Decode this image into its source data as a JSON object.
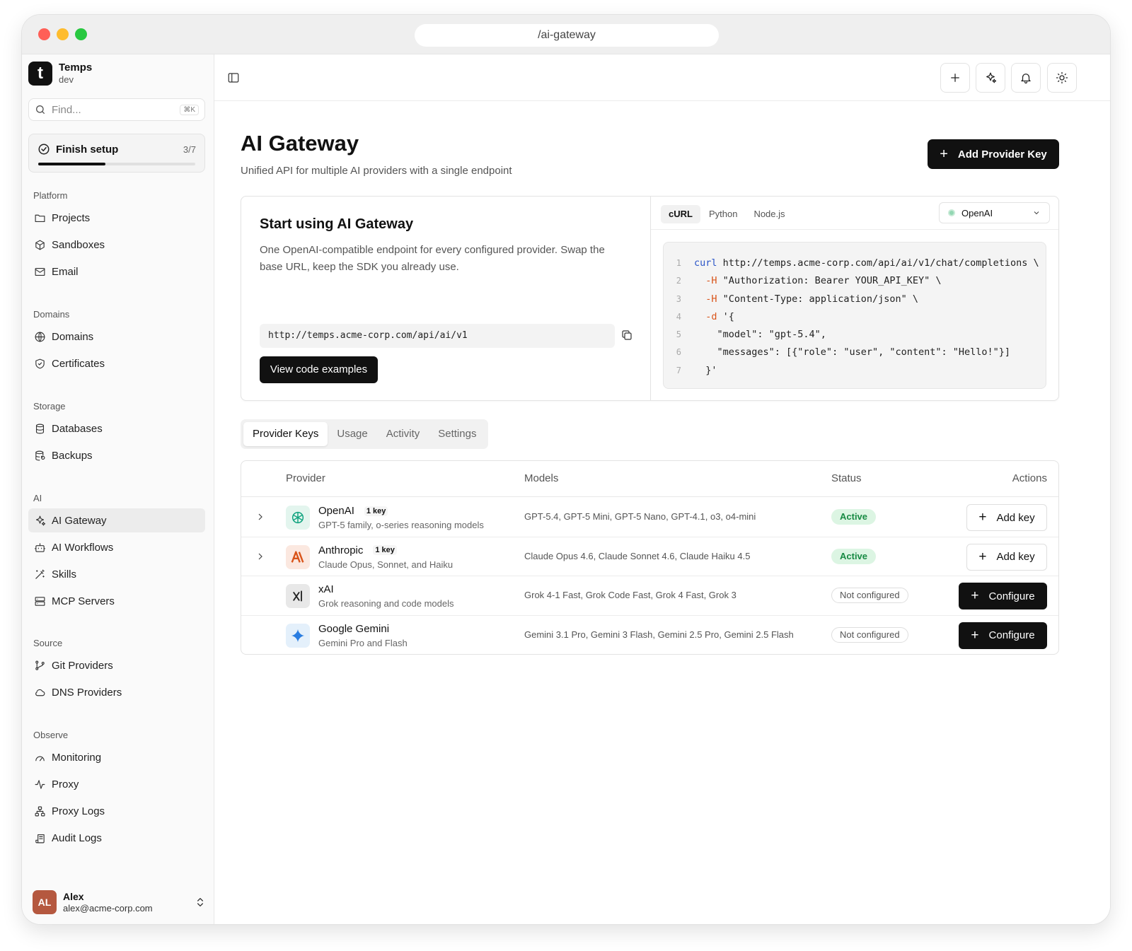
{
  "browser": {
    "url": "/ai-gateway"
  },
  "brand": {
    "logo_letter": "t",
    "name": "Temps",
    "env": "dev"
  },
  "search": {
    "placeholder": "Find...",
    "shortcut": "⌘K"
  },
  "setup": {
    "label": "Finish setup",
    "count": "3/7",
    "progress": 0.43
  },
  "nav": {
    "platform": {
      "heading": "Platform",
      "items": [
        "Projects",
        "Sandboxes",
        "Email"
      ]
    },
    "domains": {
      "heading": "Domains",
      "items": [
        "Domains",
        "Certificates"
      ]
    },
    "storage": {
      "heading": "Storage",
      "items": [
        "Databases",
        "Backups"
      ]
    },
    "ai": {
      "heading": "AI",
      "items": [
        "AI Gateway",
        "AI Workflows",
        "Skills",
        "MCP Servers"
      ]
    },
    "source": {
      "heading": "Source",
      "items": [
        "Git Providers",
        "DNS Providers"
      ]
    },
    "observe": {
      "heading": "Observe",
      "items": [
        "Monitoring",
        "Proxy",
        "Proxy Logs",
        "Audit Logs"
      ]
    }
  },
  "user": {
    "initials": "AL",
    "name": "Alex",
    "email": "alex@acme-corp.com"
  },
  "header": {
    "title": "AI Gateway",
    "subtitle": "Unified API for multiple AI providers with a single endpoint",
    "primary_button": "Add Provider Key"
  },
  "quickstart": {
    "title": "Start using AI Gateway",
    "description": "One OpenAI-compatible endpoint for every configured provider. Swap the base URL, keep the SDK you already use.",
    "endpoint": "http://temps.acme-corp.com/api/ai/v1",
    "button": "View code examples",
    "code_tabs": [
      "cURL",
      "Python",
      "Node.js"
    ],
    "active_code_tab": "cURL",
    "selected_provider": "OpenAI",
    "code_lines": [
      {
        "n": "1",
        "kw": "curl",
        "flag": "",
        "text": " http://temps.acme-corp.com/api/ai/v1/chat/completions \\"
      },
      {
        "n": "2",
        "kw": "",
        "flag": "  -H",
        "text": " \"Authorization: Bearer YOUR_API_KEY\" \\"
      },
      {
        "n": "3",
        "kw": "",
        "flag": "  -H",
        "text": " \"Content-Type: application/json\" \\"
      },
      {
        "n": "4",
        "kw": "",
        "flag": "  -d",
        "text": " '{"
      },
      {
        "n": "5",
        "kw": "",
        "flag": "",
        "text": "    \"model\": \"gpt-5.4\","
      },
      {
        "n": "6",
        "kw": "",
        "flag": "",
        "text": "    \"messages\": [{\"role\": \"user\", \"content\": \"Hello!\"}]"
      },
      {
        "n": "7",
        "kw": "",
        "flag": "",
        "text": "  }'"
      }
    ]
  },
  "tabs": {
    "items": [
      "Provider Keys",
      "Usage",
      "Activity",
      "Settings"
    ],
    "active": "Provider Keys"
  },
  "table": {
    "columns": {
      "provider": "Provider",
      "models": "Models",
      "status": "Status",
      "actions": "Actions"
    },
    "rows": [
      {
        "name": "OpenAI",
        "badge": "1 key",
        "description": "GPT-5 family, o-series reasoning models",
        "models": "GPT-5.4, GPT-5 Mini, GPT-5 Nano, GPT-4.1, o3, o4-mini",
        "status": "Active",
        "action": "Add key",
        "icon": "openai-icon"
      },
      {
        "name": "Anthropic",
        "badge": "1 key",
        "description": "Claude Opus, Sonnet, and Haiku",
        "models": "Claude Opus 4.6, Claude Sonnet 4.6, Claude Haiku 4.5",
        "status": "Active",
        "action": "Add key",
        "icon": "anthropic-icon"
      },
      {
        "name": "xAI",
        "badge": "",
        "description": "Grok reasoning and code models",
        "models": "Grok 4-1 Fast, Grok Code Fast, Grok 4 Fast, Grok 3",
        "status": "Not configured",
        "action": "Configure",
        "icon": "xai-icon"
      },
      {
        "name": "Google Gemini",
        "badge": "",
        "description": "Gemini Pro and Flash",
        "models": "Gemini 3.1 Pro, Gemini 3 Flash, Gemini 2.5 Pro, Gemini 2.5 Flash",
        "status": "Not configured",
        "action": "Configure",
        "icon": "gemini-icon"
      }
    ]
  },
  "colors": {
    "accent": "#111111",
    "active_bg": "#dcf5e3",
    "active_text": "#178a43",
    "anthropic": "#d9541a",
    "gemini": "#2a7de1",
    "openai": "#10a37f"
  }
}
